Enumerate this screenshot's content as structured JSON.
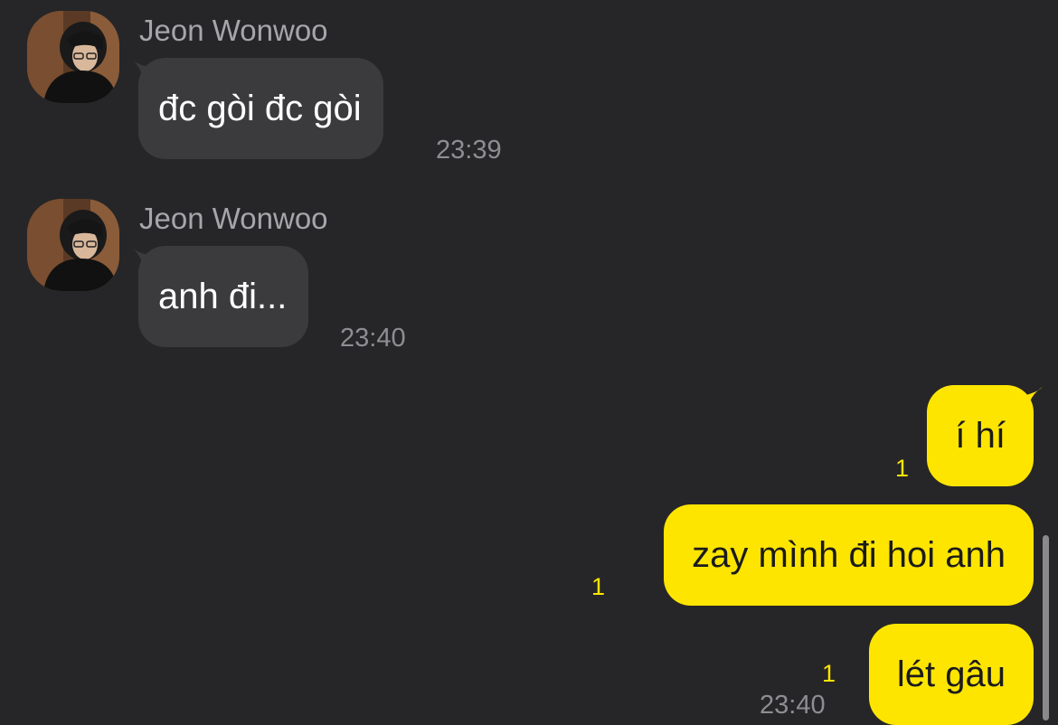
{
  "colors": {
    "background": "#262628",
    "incoming_bubble": "#3b3b3d",
    "outgoing_bubble": "#fee500",
    "unread_count": "#fee500",
    "timestamp": "#8e8e92",
    "sender_name": "#a6a6aa"
  },
  "messages": [
    {
      "direction": "incoming",
      "sender": "Jeon Wonwoo",
      "text": "đc gòi đc gòi",
      "time": "23:39"
    },
    {
      "direction": "incoming",
      "sender": "Jeon Wonwoo",
      "text": "anh đi...",
      "time": "23:40"
    },
    {
      "direction": "outgoing",
      "text": "í hí",
      "unread": "1"
    },
    {
      "direction": "outgoing",
      "text": "zay mình đi hoi anh",
      "unread": "1"
    },
    {
      "direction": "outgoing",
      "text": "lét gâu",
      "unread": "1",
      "time": "23:40"
    }
  ],
  "icons": {
    "avatar": "profile-photo",
    "scrollbar": "scrollbar-thumb"
  }
}
